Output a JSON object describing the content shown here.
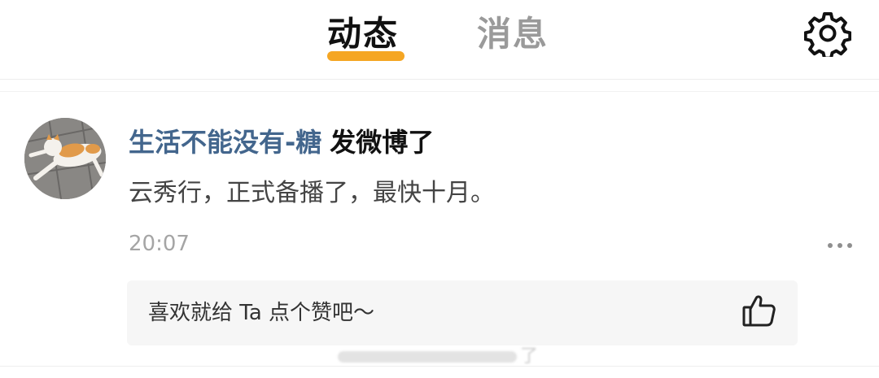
{
  "header": {
    "tabs": [
      {
        "label": "动态",
        "active": true
      },
      {
        "label": "消息",
        "active": false
      }
    ],
    "settings_icon": "gear-icon",
    "accent_color": "#f5a623"
  },
  "feed": {
    "items": [
      {
        "user_name": "生活不能没有-糖",
        "action": "发微博了",
        "content": "云秀行，正式备播了，最快十月。",
        "time": "20:07",
        "more_icon": "more-dots-icon",
        "like_prompt": "喜欢就给 Ta 点个赞吧～",
        "like_icon": "thumbs-up-icon",
        "avatar": "cat-avatar"
      }
    ],
    "next_item_fragment": "了"
  },
  "colors": {
    "user_name": "#43668d",
    "timestamp": "#a5a5a5",
    "inactive_tab": "#9a9a9a"
  }
}
